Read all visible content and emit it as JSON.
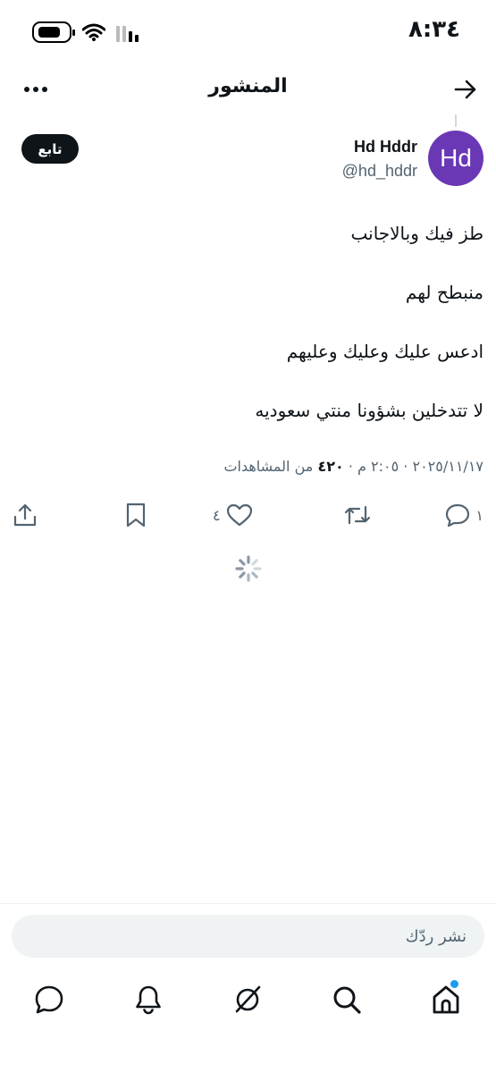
{
  "status_bar": {
    "time": "٨:٣٤",
    "icons": [
      "battery-icon",
      "wifi-icon",
      "cellular-signal-icon"
    ]
  },
  "header": {
    "title": "المنشور",
    "back_icon": "arrow-right-icon",
    "more_icon": "more-horizontal-icon"
  },
  "post": {
    "avatar_text": "Hd",
    "author_name": "Hd Hddr",
    "author_handle": "@hd_hddr",
    "follow_label": "تابع",
    "lines": [
      "طز فيك وبالاجانب",
      "منبطح لهم",
      "ادعس عليك وعليك وعليهم",
      "لا تتدخلين بشؤونا منتي سعوديه"
    ],
    "meta": {
      "time": "٢:٠٥ م",
      "separator": "·",
      "date": "٢٠٢٥/١١/١٧",
      "views_count": "٤٢٠",
      "views_label": "من المشاهدات"
    }
  },
  "actions": {
    "reply": {
      "icon": "reply-icon",
      "count": "١"
    },
    "repost": {
      "icon": "repost-icon"
    },
    "like": {
      "icon": "heart-icon",
      "count": "٤"
    },
    "bookmark": {
      "icon": "bookmark-icon"
    },
    "share": {
      "icon": "share-icon"
    }
  },
  "reply_bar": {
    "placeholder": "نشر ردّك"
  },
  "bottom_nav": {
    "items": [
      "home-icon",
      "search-icon",
      "grok-icon",
      "notifications-icon",
      "messages-icon"
    ],
    "accent_color": "#1d9bf0"
  },
  "colors": {
    "avatar_bg": "#6a38b5",
    "text_primary": "#0f1419",
    "text_secondary": "#536471"
  }
}
